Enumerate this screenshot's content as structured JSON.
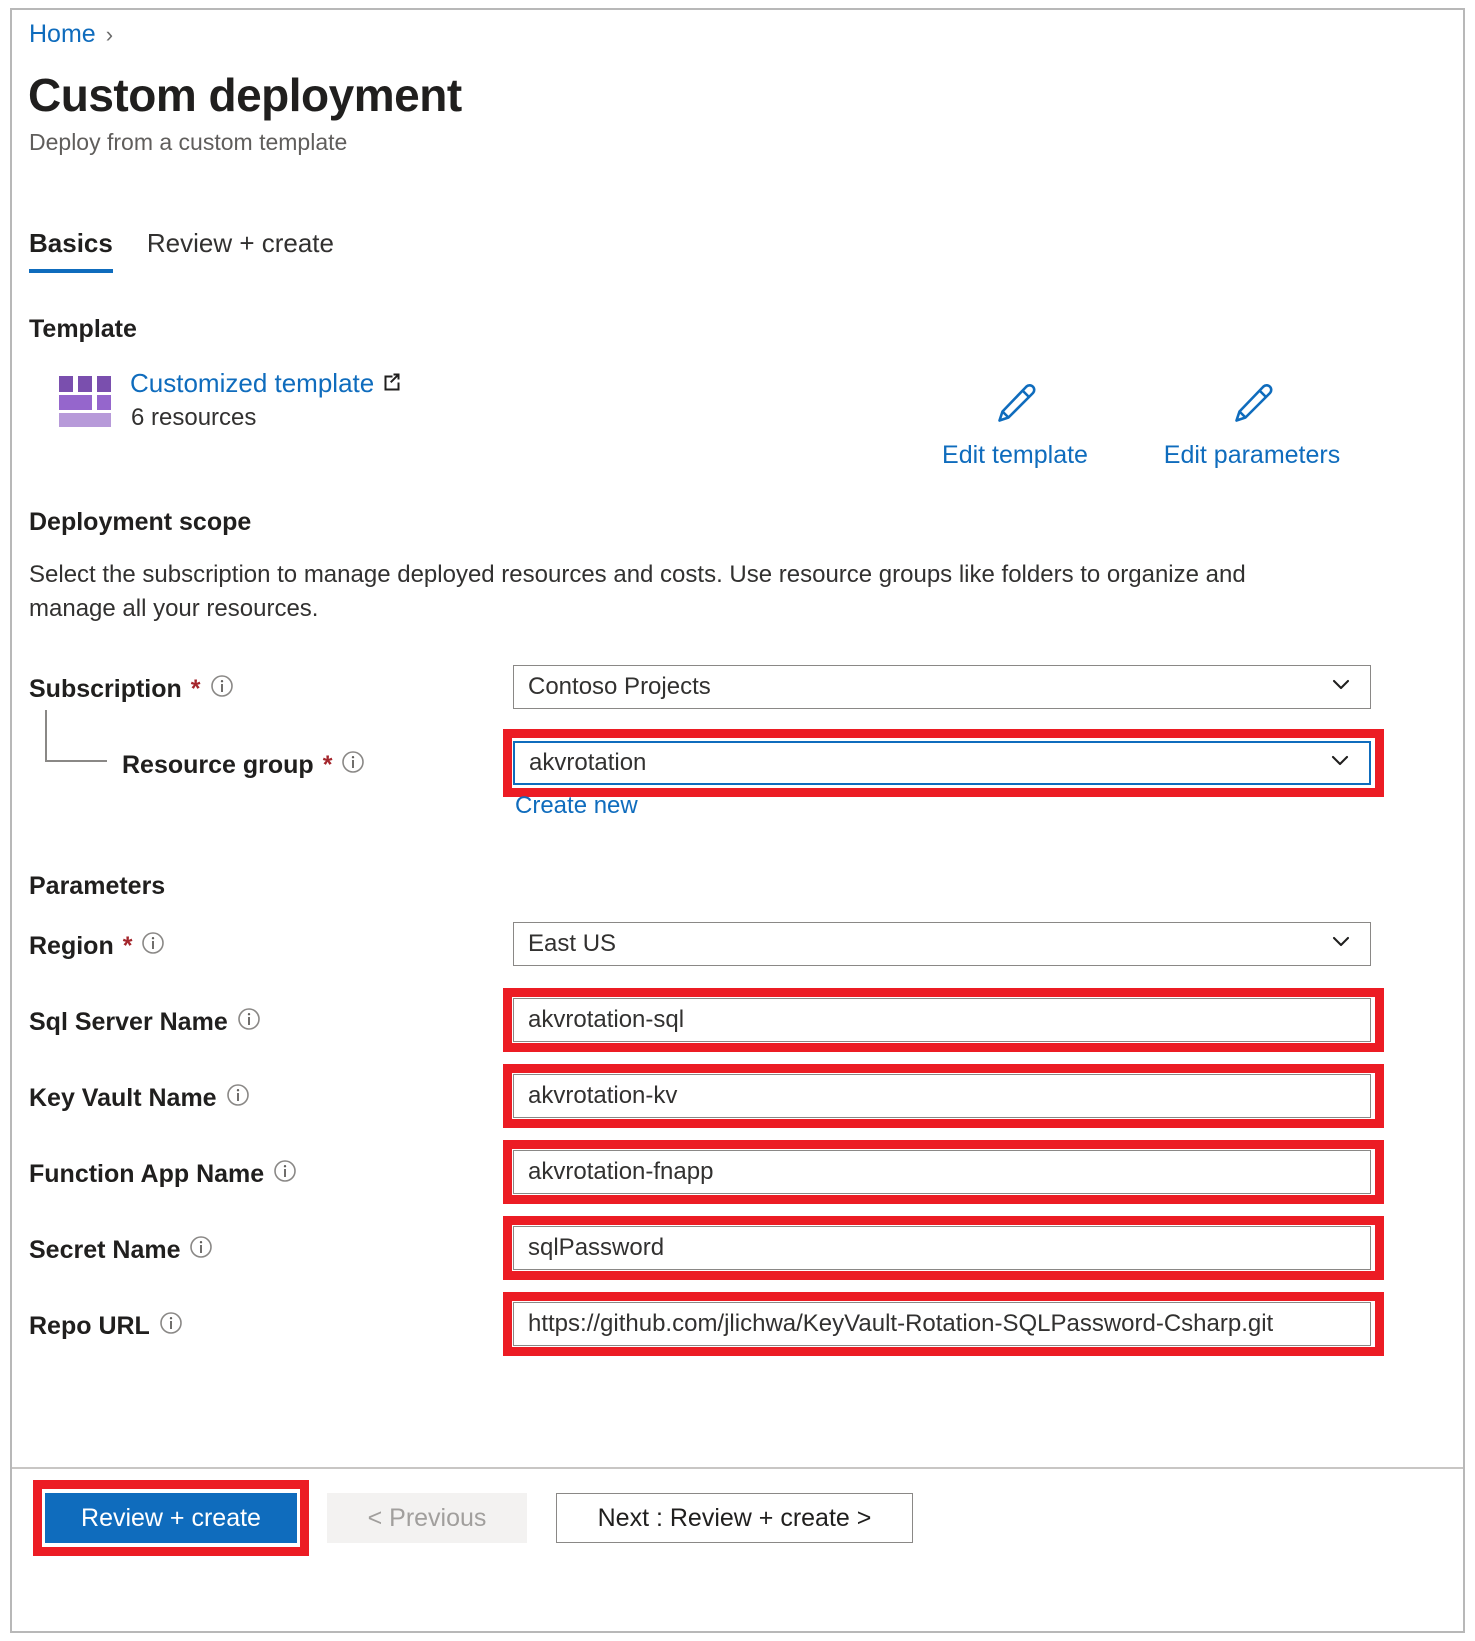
{
  "breadcrumb": {
    "home": "Home",
    "separator": "›"
  },
  "header": {
    "title": "Custom deployment",
    "subtitle": "Deploy from a custom template"
  },
  "tabs": [
    {
      "label": "Basics",
      "active": true
    },
    {
      "label": "Review + create",
      "active": false
    }
  ],
  "template": {
    "heading": "Template",
    "link_label": "Customized template",
    "resources_count": "6 resources",
    "icon": "template-grid-icon",
    "external_link_icon": "external-link-icon",
    "edit_template_label": "Edit template",
    "edit_parameters_label": "Edit parameters",
    "pencil_icon": "pencil-icon"
  },
  "deployment_scope": {
    "heading": "Deployment scope",
    "description": "Select the subscription to manage deployed resources and costs. Use resource groups like folders to organize and manage all your resources.",
    "subscription": {
      "label": "Subscription",
      "required_marker": "*",
      "info_icon": "info-icon",
      "value": "Contoso Projects",
      "chevron_icon": "chevron-down-icon"
    },
    "resource_group": {
      "label": "Resource group",
      "required_marker": "*",
      "info_icon": "info-icon",
      "value": "akvrotation",
      "chevron_icon": "chevron-down-icon",
      "create_new_label": "Create new",
      "highlighted": true
    }
  },
  "parameters": {
    "heading": "Parameters",
    "fields": [
      {
        "label": "Region",
        "required_marker": "*",
        "value": "East US",
        "type": "select",
        "highlighted": false
      },
      {
        "label": "Sql Server Name",
        "required_marker": "",
        "value": "akvrotation-sql",
        "type": "text",
        "highlighted": true
      },
      {
        "label": "Key Vault Name",
        "required_marker": "",
        "value": "akvrotation-kv",
        "type": "text",
        "highlighted": true
      },
      {
        "label": "Function App Name",
        "required_marker": "",
        "value": "akvrotation-fnapp",
        "type": "text",
        "highlighted": true
      },
      {
        "label": "Secret Name",
        "required_marker": "",
        "value": "sqlPassword",
        "type": "text",
        "highlighted": true
      },
      {
        "label": "Repo URL",
        "required_marker": "",
        "value": "https://github.com/jlichwa/KeyVault-Rotation-SQLPassword-Csharp.git",
        "type": "text",
        "highlighted": true
      }
    ]
  },
  "footer": {
    "review_create_label": "Review + create",
    "previous_label": "< Previous",
    "next_label": "Next : Review + create >",
    "review_create_highlighted": true
  },
  "colors": {
    "accent_blue": "#0f6cbd",
    "annotation_red": "#ec1c24",
    "required_red": "#a4262c",
    "template_purple": "#8661c5",
    "disabled_grey": "#f3f2f1"
  }
}
